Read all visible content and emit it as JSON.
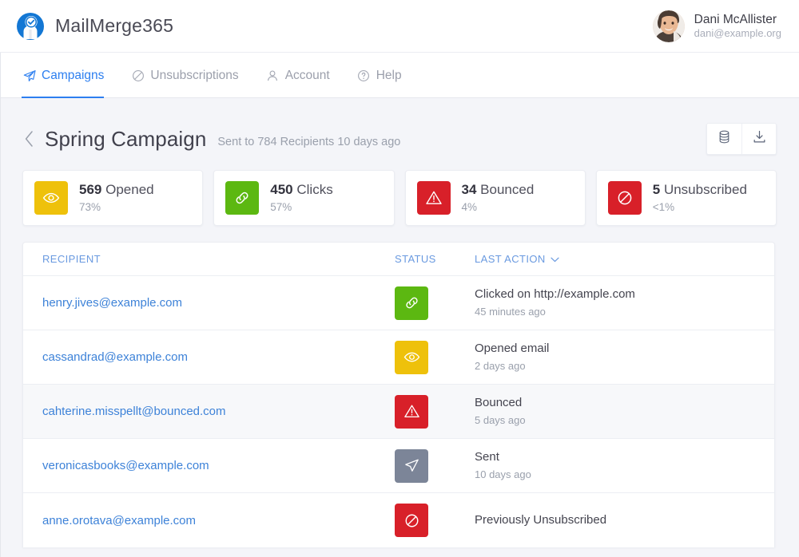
{
  "brand": {
    "name": "MailMerge365",
    "logo_icon": "mailmerge-person-check-logo"
  },
  "user": {
    "name": "Dani McAllister",
    "email": "dani@example.org",
    "avatar_icon": "user-avatar"
  },
  "nav": {
    "items": [
      {
        "label": "Campaigns",
        "icon": "paper-plane-icon",
        "active": true
      },
      {
        "label": "Unsubscriptions",
        "icon": "ban-icon",
        "active": false
      },
      {
        "label": "Account",
        "icon": "person-icon",
        "active": false
      },
      {
        "label": "Help",
        "icon": "question-circle-icon",
        "active": false
      }
    ]
  },
  "page": {
    "back_icon": "chevron-left-icon",
    "title": "Spring Campaign",
    "subtitle": "Sent to 784 Recipients 10 days ago",
    "actions": [
      {
        "name": "database-button",
        "icon": "database-icon"
      },
      {
        "name": "download-button",
        "icon": "download-icon"
      }
    ]
  },
  "stats": [
    {
      "value": "569",
      "label": "Opened",
      "percent": "73%",
      "icon": "eye-icon",
      "color": "#eec10b"
    },
    {
      "value": "450",
      "label": "Clicks",
      "percent": "57%",
      "icon": "link-icon",
      "color": "#5cb811"
    },
    {
      "value": "34",
      "label": "Bounced",
      "percent": "4%",
      "icon": "warning-triangle-icon",
      "color": "#d82029"
    },
    {
      "value": "5",
      "label": "Unsubscribed",
      "percent": "<1%",
      "icon": "ban-icon",
      "color": "#d82029"
    }
  ],
  "table": {
    "columns": {
      "recipient": "RECIPIENT",
      "status": "STATUS",
      "last_action": "LAST ACTION",
      "sort_icon": "chevron-down-icon"
    },
    "rows": [
      {
        "recipient": "henry.jives@example.com",
        "status_icon": "link-icon",
        "status_color": "#5cb811",
        "action": "Clicked on http://example.com",
        "time": "45 minutes ago",
        "highlighted": false
      },
      {
        "recipient": "cassandrad@example.com",
        "status_icon": "eye-icon",
        "status_color": "#eec10b",
        "action": "Opened email",
        "time": "2 days ago",
        "highlighted": false
      },
      {
        "recipient": "cahterine.misspellt@bounced.com",
        "status_icon": "warning-triangle-icon",
        "status_color": "#d82029",
        "action": "Bounced",
        "time": "5 days ago",
        "highlighted": true
      },
      {
        "recipient": "veronicasbooks@example.com",
        "status_icon": "paper-plane-icon",
        "status_color": "#7c8598",
        "action": "Sent",
        "time": "10 days ago",
        "highlighted": false
      },
      {
        "recipient": "anne.orotava@example.com",
        "status_icon": "ban-icon",
        "status_color": "#d82029",
        "action": "Previously Unsubscribed",
        "time": "",
        "highlighted": false
      }
    ]
  },
  "colors": {
    "accent": "#2d7ff0",
    "link": "#3d82d8",
    "header_link": "#6a9ae0",
    "page_bg": "#f4f5f9"
  }
}
